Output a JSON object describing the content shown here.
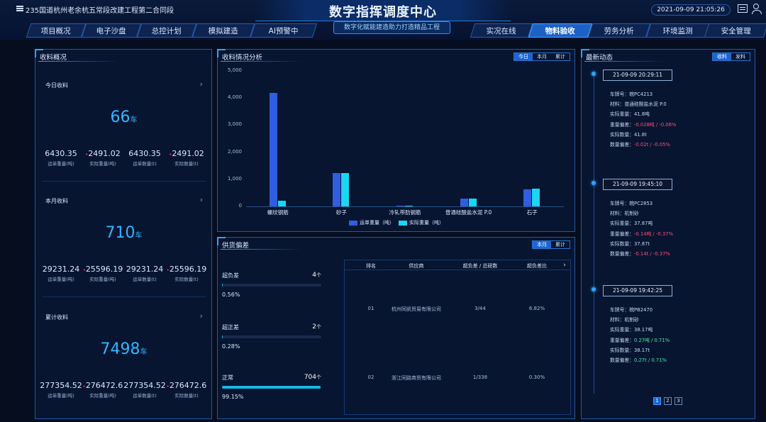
{
  "header": {
    "project": "235国道杭州老余杭五常段改建工程第二合同段",
    "title": "数字指挥调度中心",
    "subtitle": "数字化赋能建造助力打造精品工程",
    "datetime": "2021-09-09 21:05:26"
  },
  "nav": {
    "tabs": [
      "项目概况",
      "电子沙盘",
      "总控计划",
      "模拟建造",
      "AI预警中",
      "实况在线",
      "物料验收",
      "劳务分析",
      "环境监测",
      "安全管理"
    ],
    "active": "物料验收"
  },
  "receipt": {
    "title": "收料概况",
    "sections": [
      {
        "label": "今日收料",
        "big": "66",
        "unit": "车",
        "stats": [
          {
            "v": "6430.35",
            "l": "运单重量(吨)"
          },
          {
            "v": "2491.02",
            "l": "实际重量(吨)",
            "mark": "•"
          },
          {
            "v": "6430.35",
            "l": "运单数量(t)"
          },
          {
            "v": "2491.02",
            "l": "实际数量(t)",
            "mark": "•"
          }
        ]
      },
      {
        "label": "本月收料",
        "big": "710",
        "unit": "车",
        "stats": [
          {
            "v": "29231.24",
            "l": "运单重量(吨)"
          },
          {
            "v": "25596.19",
            "l": "实际重量(吨)",
            "mark": "•"
          },
          {
            "v": "29231.24",
            "l": "运单数量(t)"
          },
          {
            "v": "25596.19",
            "l": "实际数量(t)",
            "mark": "•"
          }
        ]
      },
      {
        "label": "累计收料",
        "big": "7498",
        "unit": "车",
        "stats": [
          {
            "v": "277354.52",
            "l": "运单重量(吨)"
          },
          {
            "v": "276472.6",
            "l": "实际重量(吨)",
            "mark": "•"
          },
          {
            "v": "277354.52",
            "l": "运单数量(t)"
          },
          {
            "v": "276472.6",
            "l": "实际数量(t)",
            "mark": "•"
          }
        ]
      }
    ]
  },
  "analysis": {
    "title": "收料情况分析",
    "toggle": [
      "今日",
      "本月",
      "累计"
    ],
    "toggle_active": 0
  },
  "chart_data": {
    "type": "bar",
    "categories": [
      "螺纹钢筋",
      "砂子",
      "冷轧带肋钢筋",
      "普通硅酸盐水泥 P.0",
      "石子"
    ],
    "series": [
      {
        "name": "运单重量（吨）",
        "color": "#2f5fe0",
        "values": [
          4200,
          1230,
          30,
          300,
          640
        ]
      },
      {
        "name": "实际重量（吨）",
        "color": "#19d6f2",
        "values": [
          220,
          1220,
          30,
          300,
          650
        ]
      }
    ],
    "yticks": [
      "5,000",
      "4,000",
      "3,000",
      "2,000",
      "1,000",
      "0"
    ],
    "ylim": [
      0,
      5000
    ]
  },
  "supply": {
    "title": "供货偏差",
    "toggle": [
      "本月",
      "累计"
    ],
    "toggle_active": 0,
    "items": [
      {
        "name": "超负差",
        "count": "4",
        "unit": "个",
        "pct": "0.56%",
        "frac": 0.0056
      },
      {
        "name": "超正差",
        "count": "2",
        "unit": "个",
        "pct": "0.28%",
        "frac": 0.0028
      },
      {
        "name": "正常",
        "count": "704",
        "unit": "个",
        "pct": "99.15%",
        "frac": 0.9915
      }
    ],
    "table": {
      "headers": [
        "排名",
        "供应商",
        "超负差 / 总磅数",
        "超负差比"
      ],
      "more": "›",
      "rows": [
        [
          "01",
          "杭州同凯贸易有限公司",
          "3/44",
          "6.82%"
        ],
        [
          "02",
          "浙江同路商贸有限公司",
          "1/338",
          "0.30%"
        ]
      ]
    }
  },
  "latest": {
    "title": "最新动态",
    "toggle": [
      "收料",
      "发料"
    ],
    "toggle_active": 0,
    "entries": [
      {
        "time": "21-09-09 20:29:11",
        "lines": [
          {
            "k": "车牌号：",
            "v": "皖PC4213"
          },
          {
            "k": "材料：",
            "v": "普通硅酸盐水泥 P.0"
          },
          {
            "k": "实际重量：",
            "v": "41.8吨"
          },
          {
            "k": "重量偏差：",
            "v": "-0.028吨 / -0.06%",
            "tone": "red"
          },
          {
            "k": "实际数量：",
            "v": "41.8t"
          },
          {
            "k": "数量偏差：",
            "v": "-0.02t / -0.05%",
            "tone": "red"
          }
        ]
      },
      {
        "time": "21-09-09 19:45:10",
        "lines": [
          {
            "k": "车牌号：",
            "v": "皖PC2853"
          },
          {
            "k": "材料：",
            "v": "机制砂"
          },
          {
            "k": "实际重量：",
            "v": "37.87吨"
          },
          {
            "k": "重量偏差：",
            "v": "-0.14吨 / -0.37%",
            "tone": "red"
          },
          {
            "k": "实际数量：",
            "v": "37.87t"
          },
          {
            "k": "数量偏差：",
            "v": "-0.14t / -0.37%",
            "tone": "red"
          }
        ]
      },
      {
        "time": "21-09-09 19:42:25",
        "lines": [
          {
            "k": "车牌号：",
            "v": "皖PB2470"
          },
          {
            "k": "材料：",
            "v": "机制砂"
          },
          {
            "k": "实际重量：",
            "v": "38.17吨"
          },
          {
            "k": "重量偏差：",
            "v": "0.27吨 / 0.71%",
            "tone": "green"
          },
          {
            "k": "实际数量：",
            "v": "38.17t"
          },
          {
            "k": "数量偏差：",
            "v": "0.27t / 0.71%",
            "tone": "green"
          }
        ]
      }
    ],
    "pages": [
      "1",
      "2",
      "3"
    ],
    "page_active": 0
  }
}
